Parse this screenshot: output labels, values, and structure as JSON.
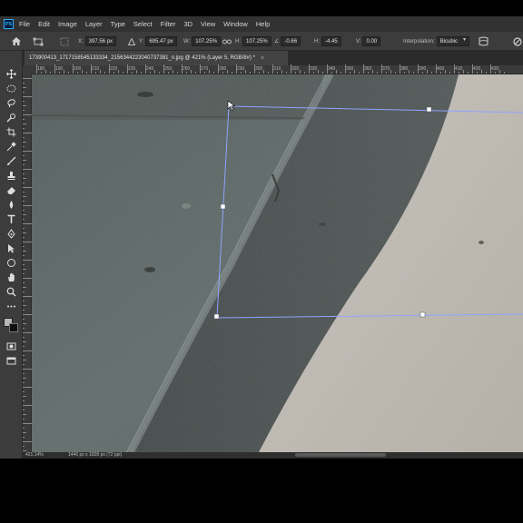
{
  "menubar": {
    "app_icon": "PS",
    "items": [
      "File",
      "Edit",
      "Image",
      "Layer",
      "Type",
      "Select",
      "Filter",
      "3D",
      "View",
      "Window",
      "Help"
    ]
  },
  "options": {
    "x_label": "X:",
    "x_value": "397.56 px",
    "y_label": "Y:",
    "y_value": "695.47 px",
    "w_label": "W:",
    "w_value": "107.25%",
    "h_label": "H:",
    "h_value": "107.25%",
    "angle_value": "-0.66",
    "hskew_label": "H:",
    "hskew_value": "-4.45",
    "vskew_label": "V:",
    "vskew_value": "0.00",
    "interpolation_label": "Interpolation:",
    "interpolation_value": "Bicubic"
  },
  "document": {
    "tab_title": "173900413_1717158545133334_2156344223040737381_n.jpg @ 421% (Layer 5, RGB/8#) *",
    "tab_close": "×"
  },
  "ruler": {
    "top_labels": [
      "180",
      "190",
      "200",
      "210",
      "220",
      "230",
      "240",
      "250",
      "260",
      "270",
      "280",
      "290",
      "300",
      "310",
      "320",
      "330",
      "340",
      "350",
      "360",
      "370",
      "380",
      "390",
      "400",
      "410",
      "420",
      "430"
    ]
  },
  "status": {
    "zoom": "421.14%",
    "doc_info": "1440 px x 1828 px (72 ppi)"
  },
  "tools": [
    "move-tool",
    "marquee-tool",
    "lasso-tool",
    "quick-select-tool",
    "crop-tool",
    "eyedropper-tool",
    "healing-tool",
    "brush-tool",
    "stamp-tool",
    "history-brush-tool",
    "eraser-tool",
    "gradient-tool",
    "blur-tool",
    "dodge-tool",
    "pen-tool",
    "type-tool",
    "path-select-tool",
    "shape-tool",
    "hand-tool",
    "zoom-tool",
    "more-tools"
  ]
}
